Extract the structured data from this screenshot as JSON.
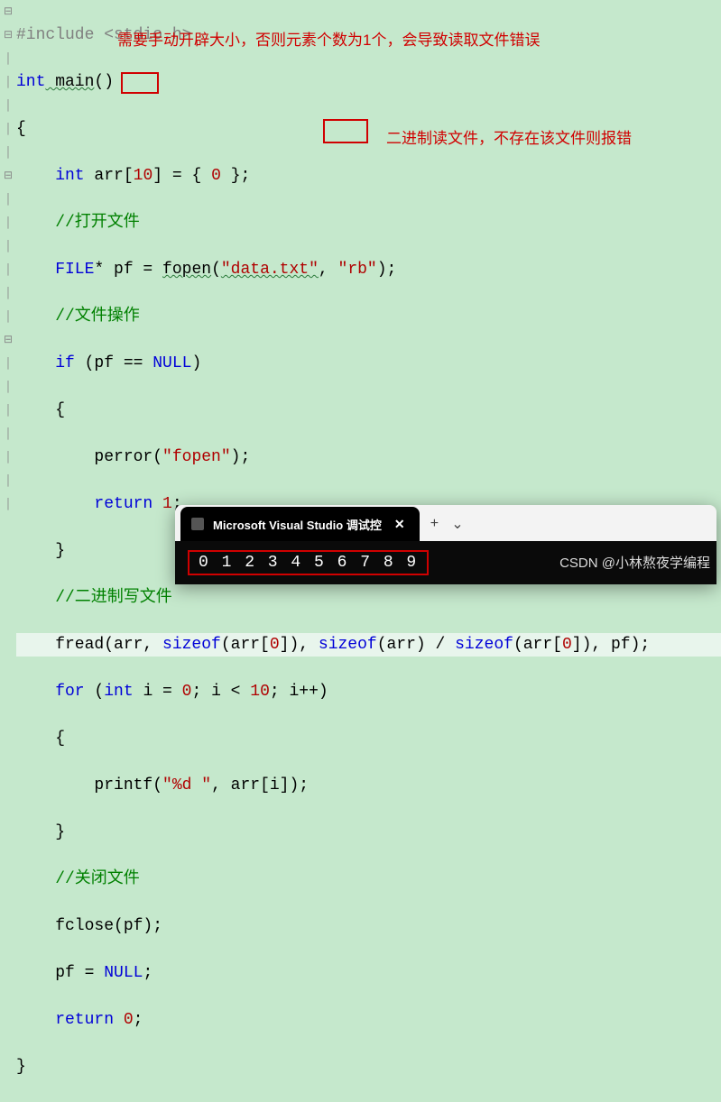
{
  "code": {
    "l1_pp": "#include ",
    "l1_angle": "<stdio.h>",
    "l2_kw1": "int",
    "l2_fn": " main",
    "l2_rest": "()",
    "l3": "{",
    "l4_kw": "    int",
    "l4_id": " arr",
    "l4_br1": "[",
    "l4_num1": "10",
    "l4_br2": "]",
    "l4_eq": " = { ",
    "l4_num2": "0",
    "l4_end": " };",
    "l5_cm": "    //打开文件",
    "l6_type": "    FILE",
    "l6_star": "* pf = ",
    "l6_fn": "fopen",
    "l6_p1": "(",
    "l6_s1": "\"data.txt\"",
    "l6_c": ", ",
    "l6_s2": "\"rb\"",
    "l6_p2": ");",
    "l7_cm": "    //文件操作",
    "l8_kw": "    if",
    "l8_rest": " (pf == ",
    "l8_null": "NULL",
    "l8_end": ")",
    "l9": "    {",
    "l10_fn": "        perror",
    "l10_p1": "(",
    "l10_s": "\"fopen\"",
    "l10_p2": ");",
    "l11_kw": "        return",
    "l11_num": " 1",
    "l11_end": ";",
    "l12": "    }",
    "l13_cm": "    //二进制写文件",
    "l14_fn": "    fread",
    "l14_p1": "(arr, ",
    "l14_sz1": "sizeof",
    "l14_a1": "(arr[",
    "l14_n1": "0",
    "l14_a2": "]), ",
    "l14_sz2": "sizeof",
    "l14_a3": "(arr) / ",
    "l14_sz3": "sizeof",
    "l14_a4": "(arr[",
    "l14_n2": "0",
    "l14_a5": "]), pf);",
    "l15_kw1": "    for",
    "l15_p1": " (",
    "l15_kw2": "int",
    "l15_r1": " i = ",
    "l15_n1": "0",
    "l15_r2": "; i < ",
    "l15_n2": "10",
    "l15_r3": "; i++)",
    "l16": "    {",
    "l17_fn": "        printf",
    "l17_p1": "(",
    "l17_s": "\"%d \"",
    "l17_p2": ", arr[i]);",
    "l18": "    }",
    "l19_cm": "    //关闭文件",
    "l20_fn": "    fclose",
    "l20_r": "(pf);",
    "l21_r1": "    pf = ",
    "l21_null": "NULL",
    "l21_r2": ";",
    "l22_kw": "    return",
    "l22_num": " 0",
    "l22_end": ";",
    "l23": "}"
  },
  "annotations": {
    "a1": "需要手动开辟大小，否则元素个数为1个，会导致读取文件错误",
    "a2": "二进制读文件，不存在该文件则报错"
  },
  "terminal": {
    "tab_title": "Microsoft Visual Studio 调试控",
    "output": "0 1 2 3 4 5 6 7 8 9"
  },
  "watermark": "CSDN @小林熬夜学编程",
  "fold_glyphs": {
    "minus": "⊟",
    "bar": "│"
  }
}
